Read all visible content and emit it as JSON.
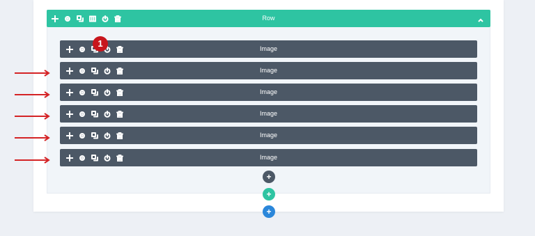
{
  "colors": {
    "row_header": "#2ec4a2",
    "module_bar": "#4c5866",
    "badge": "#c8161d",
    "arrow": "#d42325",
    "add_section": "#2b87da"
  },
  "row": {
    "title": "Row",
    "toolbar_icons": [
      "move-icon",
      "gear-icon",
      "duplicate-icon",
      "columns-icon",
      "power-icon",
      "trash-icon"
    ],
    "collapse_icon": "chevron-up-icon"
  },
  "modules": [
    {
      "title": "Image"
    },
    {
      "title": "Image"
    },
    {
      "title": "Image"
    },
    {
      "title": "Image"
    },
    {
      "title": "Image"
    },
    {
      "title": "Image"
    }
  ],
  "module_toolbar_icons": [
    "move-icon",
    "gear-icon",
    "duplicate-icon",
    "power-icon",
    "trash-icon"
  ],
  "badge": {
    "text": "1"
  },
  "add_buttons": {
    "module": "+",
    "row": "+",
    "section": "+"
  }
}
